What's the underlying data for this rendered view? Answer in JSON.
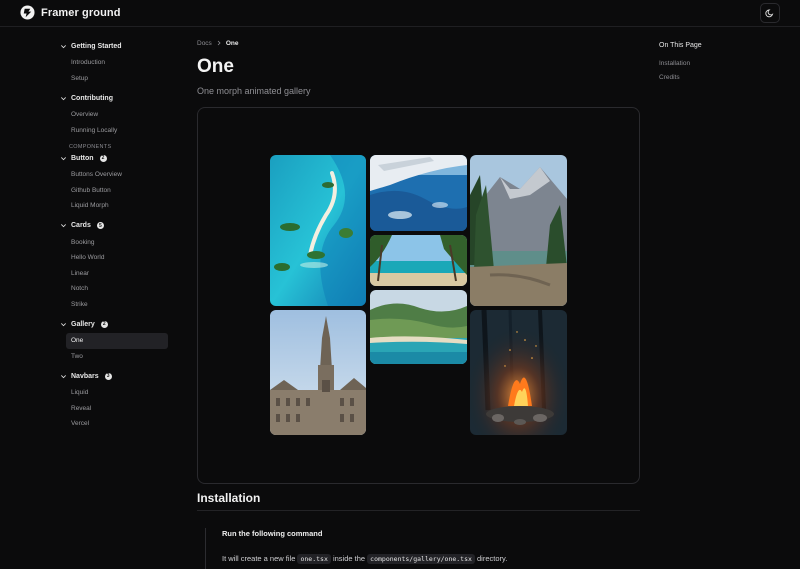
{
  "header": {
    "brand": "Framer ground",
    "theme_icon": "moon-icon"
  },
  "sidebar": {
    "groups": [
      {
        "title": "Getting Started",
        "items": [
          "Introduction",
          "Setup"
        ]
      },
      {
        "title": "Contributing",
        "items": [
          "Overview",
          "Running Locally"
        ]
      }
    ],
    "section_label": "COMPONENTS",
    "components": [
      {
        "title": "Button",
        "count": "2",
        "items": [
          "Buttons Overview",
          "Github Button",
          "Liquid Morph"
        ]
      },
      {
        "title": "Cards",
        "count": "5",
        "items": [
          "Booking",
          "Hello World",
          "Linear",
          "Notch",
          "Strike"
        ]
      },
      {
        "title": "Gallery",
        "count": "2",
        "items": [
          "One",
          "Two"
        ],
        "active": "One"
      },
      {
        "title": "Navbars",
        "count": "3",
        "items": [
          "Liquid",
          "Reveal",
          "Vercel"
        ]
      }
    ]
  },
  "breadcrumb": {
    "root": "Docs",
    "current": "One"
  },
  "page": {
    "title": "One",
    "subtitle": "One morph animated gallery"
  },
  "installation": {
    "title": "Installation",
    "step_title": "Run the following command",
    "text_before": "It will create a new file",
    "file": "one.tsx",
    "text_mid": "inside the",
    "path": "components/gallery/one.tsx",
    "text_after": "directory."
  },
  "toc": {
    "title": "On This Page",
    "items": [
      "Installation",
      "Credits"
    ]
  },
  "colors": {
    "background": "#0b0b0c",
    "accent": "#ffffff",
    "muted": "#8f8f94"
  }
}
